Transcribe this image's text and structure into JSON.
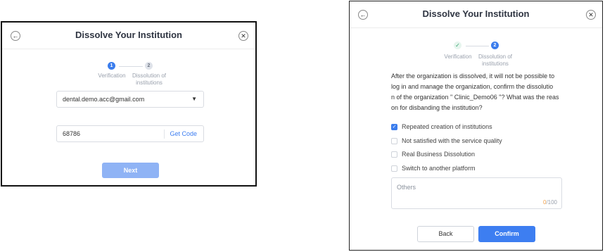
{
  "verification_step": {
    "title": "Dissolve Your Institution",
    "back_icon": "arrow-left-icon",
    "close_icon": "close-icon",
    "steps": [
      {
        "number": "1",
        "label_line1": "Verification",
        "label_line2": "",
        "state": "active"
      },
      {
        "number": "2",
        "label_line1": "Dissolution of",
        "label_line2": "institutions",
        "state": "inactive"
      }
    ],
    "email_select": {
      "value": "dental.demo.acc@gmail.com",
      "caret": "▼"
    },
    "code_input": {
      "value": "68786",
      "get_code_label": "Get Code"
    },
    "next_label": "Next"
  },
  "dissolution_step": {
    "title": "Dissolve Your Institution",
    "back_icon": "arrow-left-icon",
    "close_icon": "close-icon",
    "steps": [
      {
        "number": "✓",
        "label_line1": "Verification",
        "label_line2": "",
        "state": "done"
      },
      {
        "number": "2",
        "label_line1": "Dissolution of",
        "label_line2": "institutions",
        "state": "active"
      }
    ],
    "description_lines": [
      "After the organization is dissolved, it will not be possible to",
      "log in and manage the organization, confirm the dissolutio",
      "n of the organization \" Clinic_Demo06 \"? What was the reas",
      "on for disbanding the institution?"
    ],
    "reasons": [
      {
        "label": "Repeated creation of institutions",
        "checked": true
      },
      {
        "label": "Not satisfied with the service quality",
        "checked": false
      },
      {
        "label": "Real Business Dissolution",
        "checked": false
      },
      {
        "label": "Switch to another platform",
        "checked": false
      }
    ],
    "others": {
      "placeholder": "Others",
      "count": "0",
      "max": "/100"
    },
    "back_label": "Back",
    "confirm_label": "Confirm"
  },
  "colors": {
    "primary": "#3d7ef1",
    "success": "#2fa36b",
    "counter": "#f0a04b"
  }
}
